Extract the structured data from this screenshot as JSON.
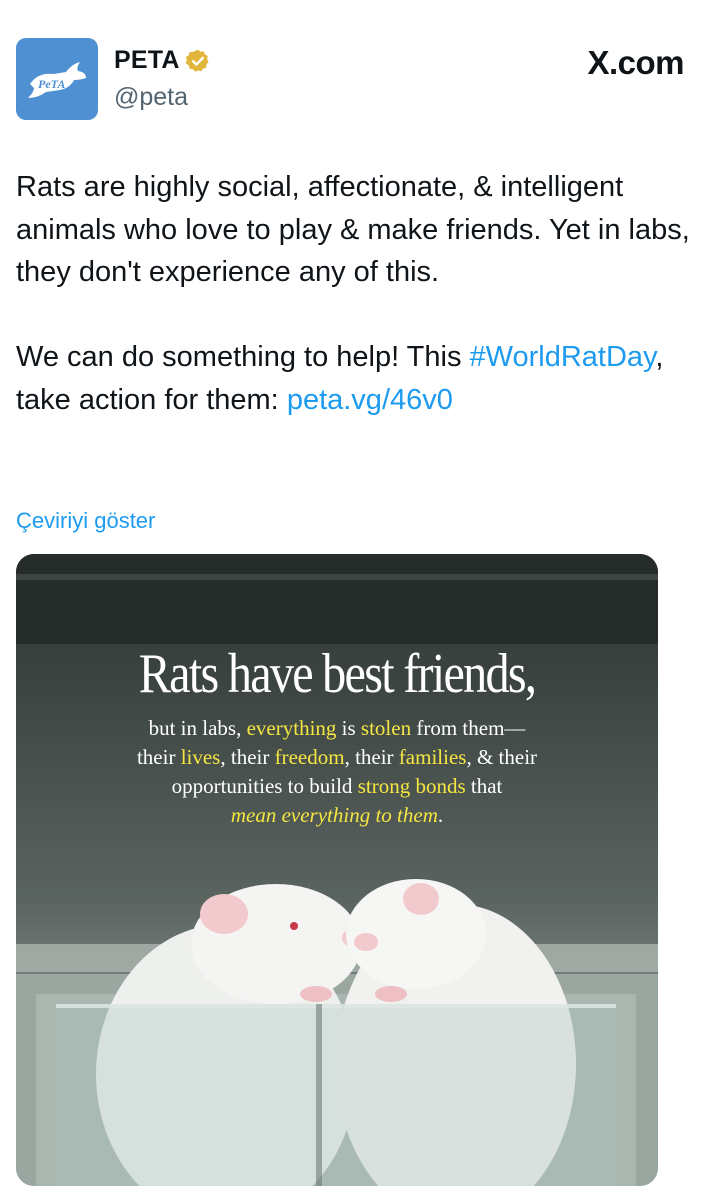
{
  "author": {
    "display_name": "PETA",
    "handle": "@peta",
    "avatar_text": "PeTA",
    "verified_icon": "verified-badge-icon"
  },
  "brand": {
    "label": "X.com"
  },
  "tweet": {
    "paragraph1": "Rats are highly social, affectionate, & intelligent animals who love to play & make friends. Yet in labs, they don't experience any of this.",
    "paragraph2_text": "We can do something to help! This ",
    "hashtag": "#WorldRatDay",
    "paragraph2_mid": ", take action for them: ",
    "link": "peta.vg/46v0"
  },
  "translate_label": "Çeviriyi göster",
  "media": {
    "title": "Rats have best friends,",
    "line1_a": "but in labs, ",
    "line1_hl1": "everything",
    "line1_b": " is ",
    "line1_hl2": "stolen",
    "line1_c": " from them—",
    "line2_a": "their ",
    "line2_hl1": "lives",
    "line2_b": ", their ",
    "line2_hl2": "freedom",
    "line2_c": ", their ",
    "line2_hl3": "families",
    "line2_d": ", & their",
    "line3_a": "opportunities to build ",
    "line3_hl": "strong bonds",
    "line3_b": " that",
    "line4_hl": "mean everything to them",
    "line4_end": "."
  },
  "colors": {
    "link": "#1d9bf0",
    "avatar_bg": "#4f90d3",
    "highlight": "#f5e642"
  }
}
